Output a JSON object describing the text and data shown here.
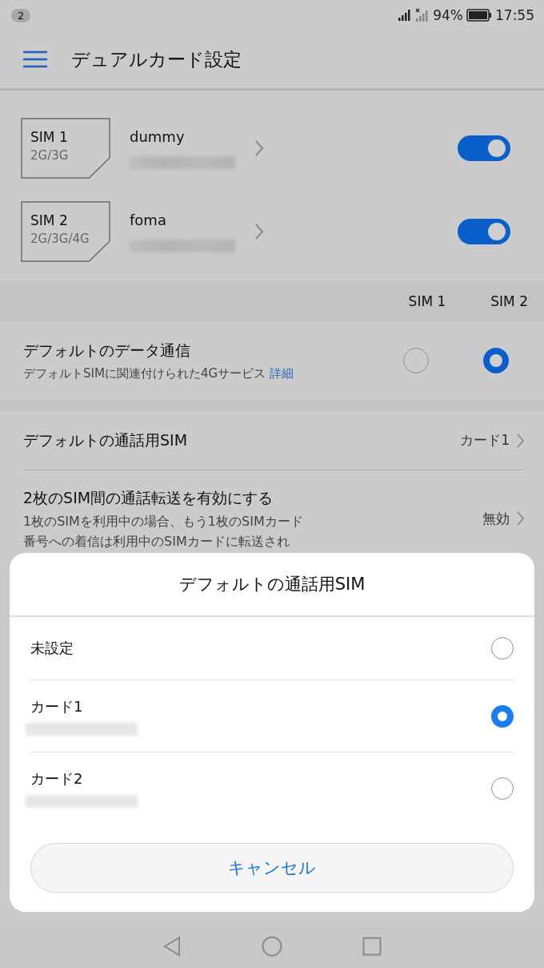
{
  "status_bar": {
    "notification_count": "2",
    "battery": "94%",
    "time": "17:55"
  },
  "app_bar": {
    "title": "デュアルカード設定"
  },
  "sims": [
    {
      "label": "SIM 1",
      "networks": "2G/3G",
      "name": "dummy",
      "on": true
    },
    {
      "label": "SIM 2",
      "networks": "2G/3G/4G",
      "name": "foma",
      "on": true
    }
  ],
  "default_data": {
    "columns": [
      "SIM 1",
      "SIM 2"
    ],
    "title": "デフォルトのデータ通信",
    "description": "デフォルトSIMに関連付けられた4Gサービス",
    "link": "詳細",
    "options": [
      {
        "selected": false
      },
      {
        "selected": true
      }
    ]
  },
  "settings": [
    {
      "title": "デフォルトの通話用SIM",
      "value": "カード1"
    },
    {
      "title": "2枚のSIM間の通話転送を有効にする",
      "description": [
        "1枚のSIMを利用中の場合、もう1枚のSIMカード",
        "番号への着信は利用中のSIMカードに転送され"
      ],
      "value": "無効"
    }
  ],
  "dialog": {
    "title": "デフォルトの通話用SIM",
    "options": [
      {
        "kind": "plain",
        "label": "未設定",
        "selected": false
      },
      {
        "kind": "card",
        "label": "カード1",
        "selected": true
      },
      {
        "kind": "card",
        "label": "カード2",
        "selected": false
      }
    ],
    "cancel": "キャンセル"
  }
}
